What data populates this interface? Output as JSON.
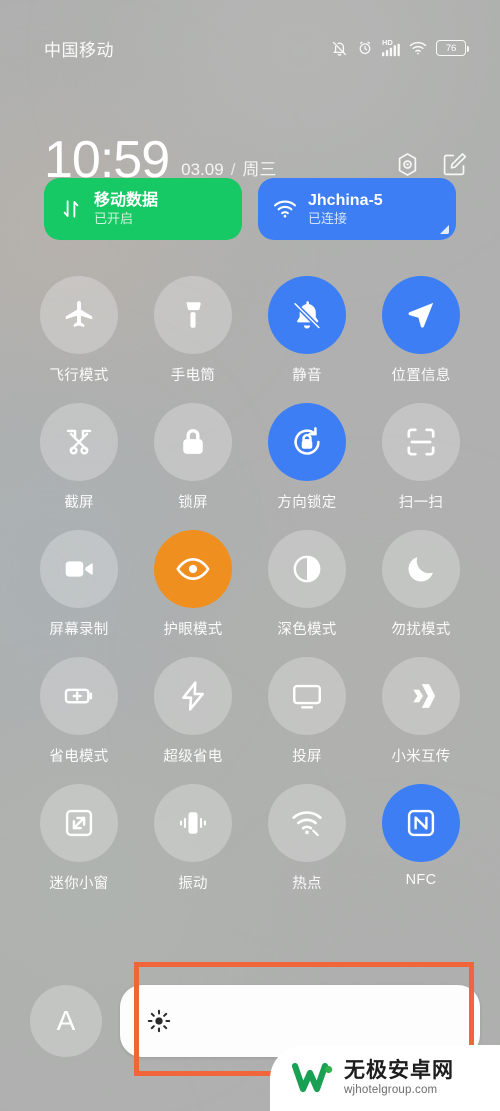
{
  "statusbar": {
    "carrier": "中国移动",
    "battery_percent": "76",
    "network_label": "HD",
    "icons": [
      "mute-bell-icon",
      "alarm-icon",
      "signal-bars-icon",
      "wifi-icon",
      "battery-icon"
    ]
  },
  "clock": {
    "time": "10:59",
    "date": "03.09",
    "separator": "/",
    "weekday": "周三",
    "settings_icon": "settings-gear-icon",
    "edit_icon": "edit-pencil-icon"
  },
  "cards": [
    {
      "name": "mobile-data",
      "title": "移动数据",
      "subtitle": "已开启",
      "icon": "data-transfer-icon",
      "color": "#17c964",
      "has_arrow": false
    },
    {
      "name": "wifi",
      "title": "Jhchina-5",
      "subtitle": "已连接",
      "icon": "wifi-icon",
      "color": "#3d7ef5",
      "has_arrow": true
    }
  ],
  "toggles": [
    [
      {
        "label": "飞行模式",
        "icon": "airplane-icon",
        "state": "off"
      },
      {
        "label": "手电筒",
        "icon": "flashlight-icon",
        "state": "off"
      },
      {
        "label": "静音",
        "icon": "bell-mute-icon",
        "state": "on-blue"
      },
      {
        "label": "位置信息",
        "icon": "location-arrow-icon",
        "state": "on-blue"
      }
    ],
    [
      {
        "label": "截屏",
        "icon": "screenshot-icon",
        "state": "off"
      },
      {
        "label": "锁屏",
        "icon": "lock-icon",
        "state": "off"
      },
      {
        "label": "方向锁定",
        "icon": "rotation-lock-icon",
        "state": "on-blue"
      },
      {
        "label": "扫一扫",
        "icon": "scan-icon",
        "state": "off"
      }
    ],
    [
      {
        "label": "屏幕录制",
        "icon": "video-camera-icon",
        "state": "off"
      },
      {
        "label": "护眼模式",
        "icon": "eye-icon",
        "state": "on-orange"
      },
      {
        "label": "深色模式",
        "icon": "contrast-circle-icon",
        "state": "off"
      },
      {
        "label": "勿扰模式",
        "icon": "moon-icon",
        "state": "off"
      }
    ],
    [
      {
        "label": "省电模式",
        "icon": "battery-saver-icon",
        "state": "off"
      },
      {
        "label": "超级省电",
        "icon": "lightning-bolt-icon",
        "state": "off"
      },
      {
        "label": "投屏",
        "icon": "cast-screen-icon",
        "state": "off"
      },
      {
        "label": "小米互传",
        "icon": "mi-share-icon",
        "state": "off"
      }
    ],
    [
      {
        "label": "迷你小窗",
        "icon": "mini-window-icon",
        "state": "off"
      },
      {
        "label": "振动",
        "icon": "vibrate-icon",
        "state": "off"
      },
      {
        "label": "热点",
        "icon": "hotspot-icon",
        "state": "off"
      },
      {
        "label": "NFC",
        "icon": "nfc-icon",
        "state": "on-blue"
      }
    ]
  ],
  "brightness": {
    "auto_label": "A",
    "icon": "sun-brightness-icon",
    "fill_percent": "100"
  },
  "highlight": {
    "name": "brightness-highlight-box",
    "color": "#f0663a"
  },
  "watermark": {
    "site_name": "无极安卓网",
    "url": "wjhotelgroup.com",
    "logo": "w-logo-icon"
  },
  "colors": {
    "accent_blue": "#3d7ef5",
    "accent_orange": "#ef8f20",
    "accent_green": "#17c964",
    "highlight": "#f0663a",
    "background": "#b2b4b2"
  }
}
